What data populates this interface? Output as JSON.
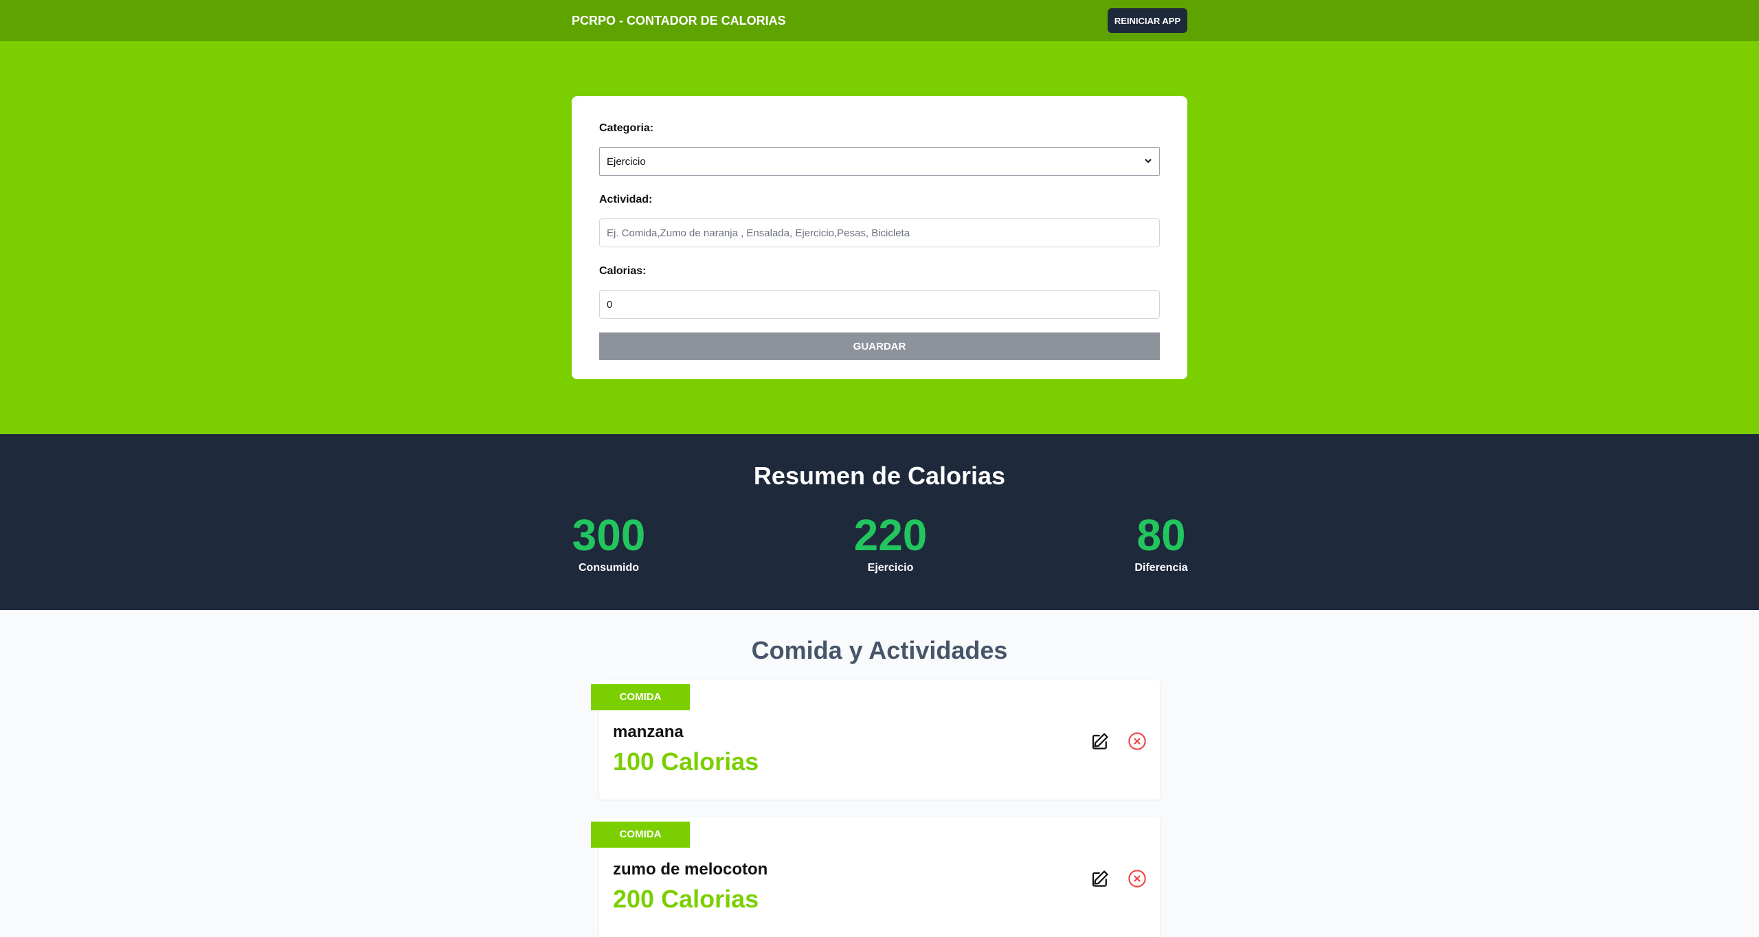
{
  "header": {
    "title": "PCRPO - CONTADOR DE CALORIAS",
    "reset_label": "REINICIAR APP"
  },
  "form": {
    "category_label": "Categoria:",
    "category_value": "Ejercicio",
    "activity_label": "Actividad:",
    "activity_placeholder": "Ej. Comida,Zumo de naranja , Ensalada, Ejercicio,Pesas, Bicicleta",
    "calories_label": "Calorias:",
    "calories_value": "0",
    "save_label": "GUARDAR"
  },
  "summary": {
    "title": "Resumen de Calorias",
    "stats": [
      {
        "value": "300",
        "label": "Consumido"
      },
      {
        "value": "220",
        "label": "Ejercicio"
      },
      {
        "value": "80",
        "label": "Diferencia"
      }
    ]
  },
  "list": {
    "title": "Comida y Actividades",
    "items": [
      {
        "category": "COMIDA",
        "name": "manzana",
        "calories": "100 Calorias"
      },
      {
        "category": "COMIDA",
        "name": "zumo de melocoton",
        "calories": "200 Calorias"
      }
    ]
  },
  "colors": {
    "accent": "#7bcf00",
    "dark": "#1e293b",
    "stat": "#22c55e",
    "delete": "#ef4444"
  }
}
